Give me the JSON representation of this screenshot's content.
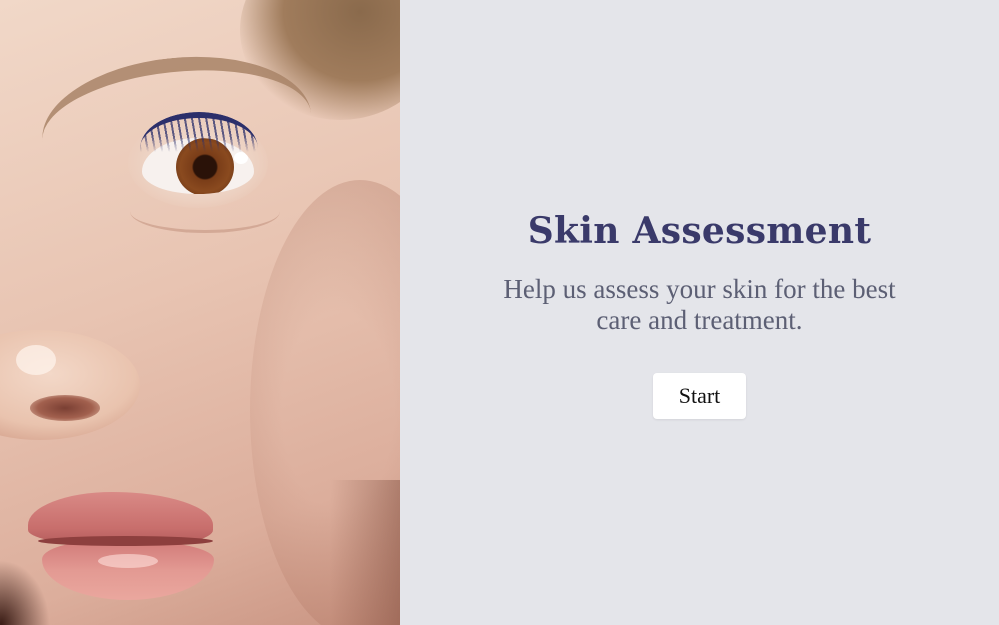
{
  "hero": {
    "image_icon": "face-closeup-photo"
  },
  "assessment": {
    "title": "Skin Assessment",
    "description": "Help us assess your skin for the best care and treatment.",
    "start_label": "Start"
  },
  "colors": {
    "background": "#e4e5ea",
    "title": "#3a3a6a",
    "description": "#5c5f74",
    "button_bg": "#ffffff",
    "button_text": "#111111"
  }
}
